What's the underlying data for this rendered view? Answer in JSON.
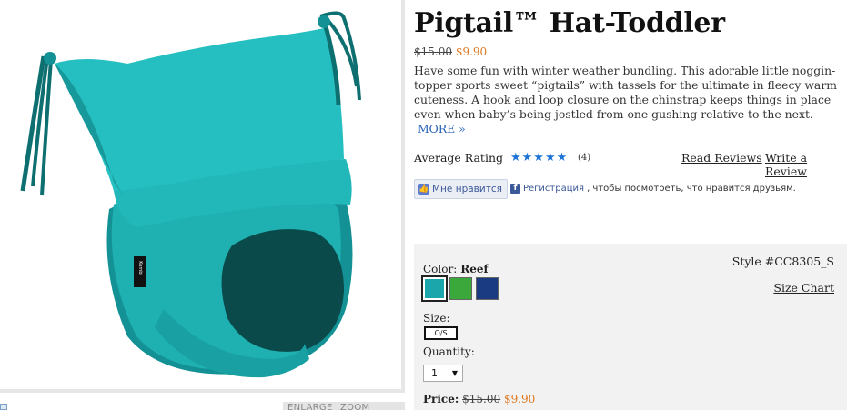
{
  "product": {
    "title": "Pigtail™ Hat-Toddler",
    "old_price": "$15.00",
    "new_price": "$9.90",
    "description": "Have some fun with winter weather bundling. This adorable little noggin-topper sports sweet “pigtails” with tassels for the ultimate in fleecy warm cuteness. A hook and loop closure on the chinstrap keeps things in place even when baby’s being jostled from one gushing relative to the next.",
    "more_link": "MORE »",
    "brand_tag": "Kombi"
  },
  "image_controls": {
    "enlarge": "ENLARGE",
    "zoom_reset": "ZOOM RESET"
  },
  "rating": {
    "label": "Average Rating",
    "stars": "★★★★★",
    "count": "(4)",
    "read_reviews": "Read Reviews",
    "write_review": "Write a Review"
  },
  "facebook": {
    "like": "Мне нравится",
    "register": "Регистрация",
    "rest": ", чтобы посмотреть, что нравится друзьям."
  },
  "options": {
    "style": "Style #CC8305_S",
    "size_chart": "Size Chart",
    "color_label": "Color:",
    "color_selected": "Reef",
    "swatches": [
      "#1aa6ab",
      "#3aa83a",
      "#1a3a82"
    ],
    "size_label": "Size:",
    "size_value": "O/S",
    "quantity_label": "Quantity:",
    "quantity_value": "1",
    "price_label": "Price:",
    "old_price": "$15.00",
    "new_price": "$9.90"
  },
  "colors": {
    "accent_orange": "#e07820",
    "link_blue": "#2a63b8",
    "hat_teal": "#1fb0b2"
  }
}
